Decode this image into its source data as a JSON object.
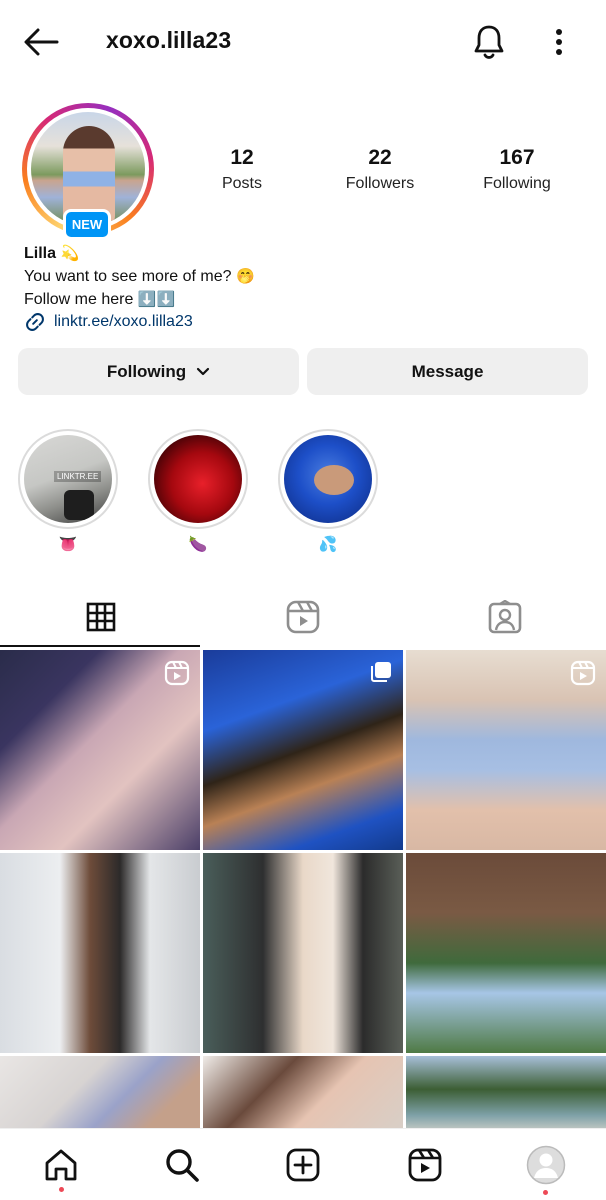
{
  "header": {
    "username": "xoxo.lilla23",
    "back_icon": "arrow-left-icon",
    "notifications_icon": "bell-icon",
    "more_icon": "more-vertical-icon"
  },
  "profile": {
    "new_badge": "NEW",
    "stats": [
      {
        "value": "12",
        "label": "Posts"
      },
      {
        "value": "22",
        "label": "Followers"
      },
      {
        "value": "167",
        "label": "Following"
      }
    ],
    "bio": {
      "name": "Lilla",
      "name_emoji": "💫",
      "line1": "You want to see more of me?",
      "line1_emoji": "🤭",
      "line2": "Follow me here",
      "line2_emoji": "⬇️⬇️",
      "link": "linktr.ee/xoxo.lilla23"
    }
  },
  "actions": {
    "following_label": "Following",
    "message_label": "Message"
  },
  "highlights": [
    {
      "caption": "👅",
      "overlay_text": "LINKTR.EE"
    },
    {
      "caption": "🍆"
    },
    {
      "caption": "💦"
    }
  ],
  "tabs": [
    "posts-grid-icon",
    "reels-icon",
    "tagged-icon"
  ],
  "posts": [
    {
      "badge": "reel-icon"
    },
    {
      "badge": "carousel-icon"
    },
    {
      "badge": "reel-icon"
    },
    {
      "badge": ""
    },
    {
      "badge": ""
    },
    {
      "badge": ""
    },
    {
      "badge": ""
    },
    {
      "badge": ""
    },
    {
      "badge": ""
    }
  ],
  "bottom_nav": [
    "home-icon",
    "search-icon",
    "create-icon",
    "reels-icon",
    "profile-avatar"
  ],
  "colors": {
    "accent_blue": "#0095f6",
    "link": "#00376b",
    "button_bg": "#efefef",
    "notification_dot": "#ed4956"
  }
}
